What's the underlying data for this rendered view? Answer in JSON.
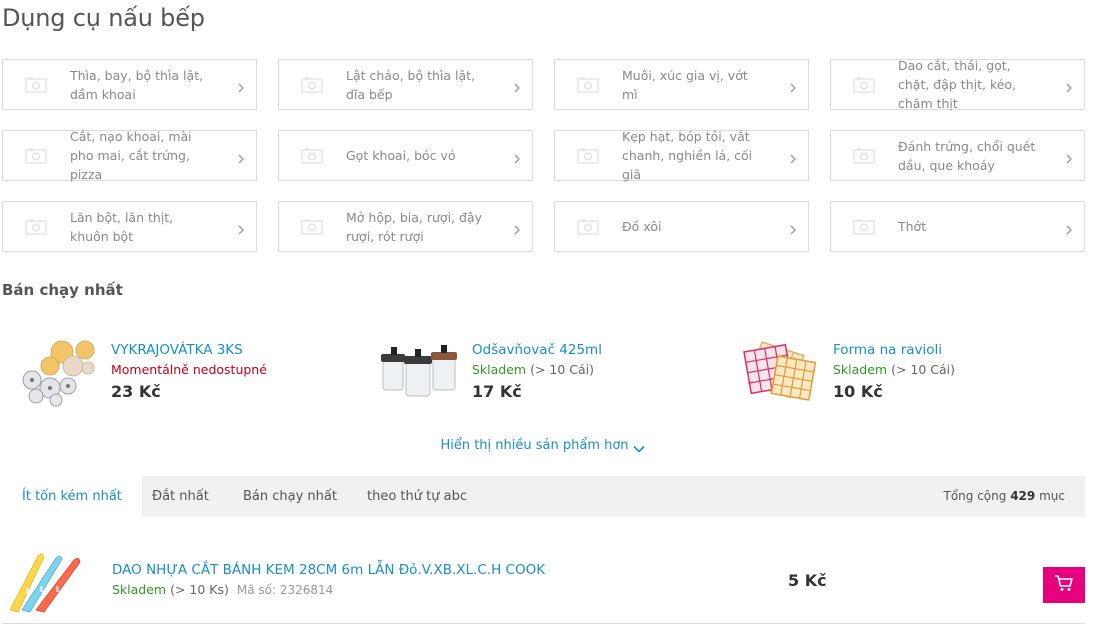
{
  "page": {
    "title": "Dụng cụ nấu bếp"
  },
  "categories": [
    {
      "label": "Thìa, bay, bộ thìa lật, dầm khoai"
    },
    {
      "label": "Lật chảo, bộ thìa lật, dĩa bếp"
    },
    {
      "label": "Muôi, xúc gia vị, vớt mì"
    },
    {
      "label": "Dao cắt, thái, gọt, chặt, đập thịt, kéo, chăm thịt"
    },
    {
      "label": "Cắt, nạo khoai, mài pho mai, cắt trứng, pizza"
    },
    {
      "label": "Gọt khoai, bóc vỏ"
    },
    {
      "label": "Kẹp hạt, bóp tỏi, vắt chanh, nghiền lá, cối giã"
    },
    {
      "label": "Đánh trứng, chổi quét dầu, que khoáy"
    },
    {
      "label": "Lăn bột, lăn thịt, khuôn bột"
    },
    {
      "label": "Mở hộp, bia, rượi, đậy rượi, rót rượi"
    },
    {
      "label": "Đồ xôi"
    },
    {
      "label": "Thớt"
    }
  ],
  "bestsellers": {
    "title": "Bán chạy nhất",
    "items": [
      {
        "name": "VYKRAJOVÁTKA 3KS",
        "stock": "Momentálně nedostupné",
        "qty": "",
        "price": "23 Kč"
      },
      {
        "name": "Odšavňovač 425ml",
        "stock": "Skladem",
        "qty": "(> 10 Cái)",
        "price": "17 Kč"
      },
      {
        "name": "Forma na ravioli",
        "stock": "Skladem",
        "qty": "(> 10 Cái)",
        "price": "10 Kč"
      }
    ],
    "show_more": "Hiển thị nhiều sản phẩm hơn"
  },
  "sort": {
    "tabs": [
      "Ít tốn kém nhất",
      "Đắt nhất",
      "Bán chạy nhất",
      "theo thứ tự abc"
    ],
    "active_index": 0,
    "total_prefix": "Tổng cộng",
    "total_count": "429",
    "total_suffix": "mục"
  },
  "products": [
    {
      "name": "DAO NHỰA CẮT BÁNH KEM 28CM 6m LẪN Đỏ.V.XB.XL.C.H COOK",
      "stock": "Skladem",
      "qty": "(> 10 Ks)",
      "code_label": "Mã số: 2326814",
      "price": "5 Kč"
    }
  ],
  "colors": {
    "accent": "#1a8fc4",
    "cart": "#e6007e",
    "in_stock": "#2e9a23",
    "out_of_stock": "#c0001a"
  },
  "icons": {
    "tile_thumb": "image-placeholder-icon",
    "tile_chevron": "chevron-right-icon",
    "show_more": "chevron-down-icon",
    "cart": "cart-icon"
  }
}
